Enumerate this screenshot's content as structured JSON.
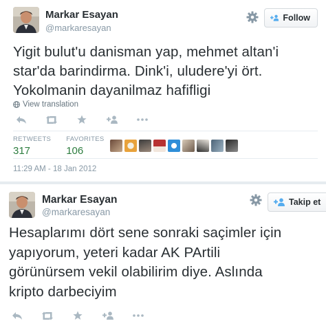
{
  "tweets": [
    {
      "display_name": "Markar Esayan",
      "handle": "@markaresayan",
      "follow_label": "Follow",
      "text_lines": [
        "Yigit bulut'u danisman yap, mehmet altan'i",
        "star'da barindirma. Dink'i, uludere'yi ört.",
        "Yokolmanin dayanilmaz hafifligi"
      ],
      "view_translation": "View translation",
      "retweets_label": "RETWEETS",
      "retweets_count": "317",
      "favorites_label": "FAVORITES",
      "favorites_count": "106",
      "timestamp": "11:29 AM - 18 Jan 2012"
    },
    {
      "display_name": "Markar Esayan",
      "handle": "@markaresayan",
      "follow_label": "Takip et",
      "text_lines": [
        "Hesaplarımı dört sene sonraki saçimler için",
        "yapıyorum, yeteri kadar AK PArtili",
        "görünürsem vekil olabilirim diye. Aslında",
        "kripto darbeciyim"
      ]
    }
  ],
  "icons": {
    "reply": "reply-icon",
    "retweet": "retweet-icon",
    "favorite": "star-icon",
    "follow": "user-plus-icon",
    "more": "more-dots-icon",
    "settings": "gear-icon",
    "translate": "globe-icon"
  },
  "colors": {
    "text": "#292f33",
    "muted": "#8899a6",
    "stat_value": "#2d7d3f",
    "icon": "#aab8c2",
    "follow_icon": "#55acee"
  }
}
